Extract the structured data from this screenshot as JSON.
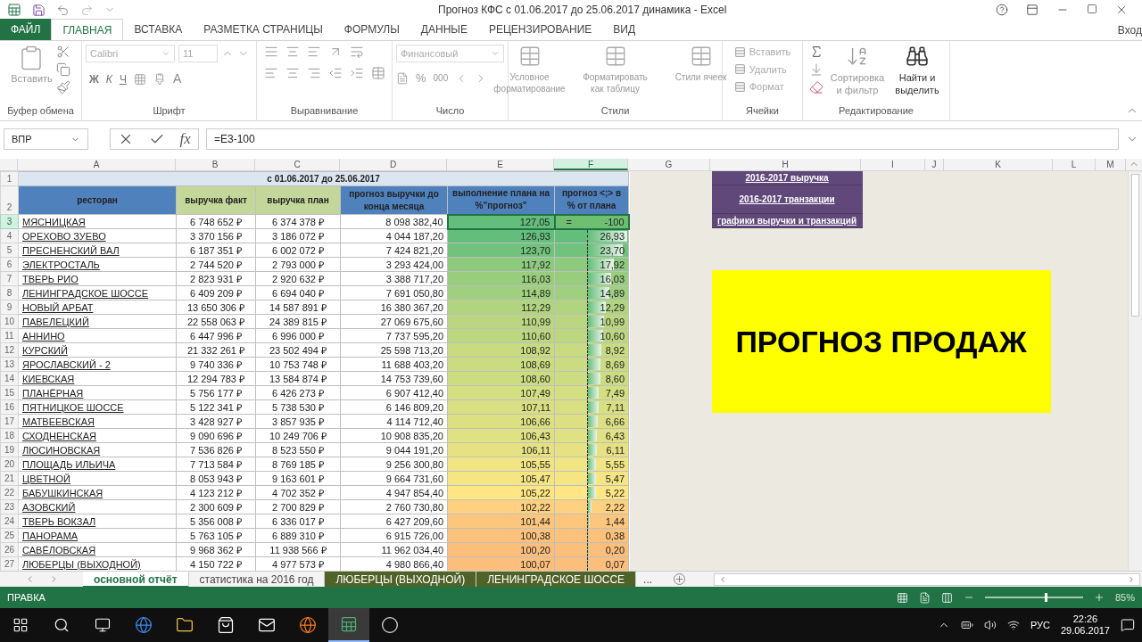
{
  "window": {
    "title": "Прогноз КФС с 01.06.2017 до 25.06.2017 динамика - Excel"
  },
  "ribbon_tabs": [
    {
      "label": "ФАЙЛ",
      "kind": "file",
      "selected": false
    },
    {
      "label": "ГЛАВНАЯ",
      "kind": "tab",
      "selected": true
    },
    {
      "label": "ВСТАВКА",
      "kind": "tab",
      "selected": false
    },
    {
      "label": "РАЗМЕТКА СТРАНИЦЫ",
      "kind": "tab",
      "selected": false
    },
    {
      "label": "ФОРМУЛЫ",
      "kind": "tab",
      "selected": false
    },
    {
      "label": "ДАННЫЕ",
      "kind": "tab",
      "selected": false
    },
    {
      "label": "РЕЦЕНЗИРОВАНИЕ",
      "kind": "tab",
      "selected": false
    },
    {
      "label": "ВИД",
      "kind": "tab",
      "selected": false
    }
  ],
  "account": "Вход",
  "ribbon": {
    "clipboard": {
      "label": "Буфер обмена",
      "paste": "Вставить"
    },
    "font": {
      "label": "Шрифт",
      "font": "Calibri",
      "size": "11",
      "bold": "Ж",
      "italic": "К",
      "underline": "Ч",
      "color_letter": "A"
    },
    "alignment": {
      "label": "Выравнивание"
    },
    "number": {
      "label": "Число",
      "format": "Финансовый",
      "percent": "%",
      "thousands": "000"
    },
    "styles": {
      "label": "Стили",
      "buttons": [
        "Условное форматирование",
        "Форматировать как таблицу",
        "Стили ячеек"
      ]
    },
    "cells": {
      "label": "Ячейки",
      "items": [
        "Вставить",
        "Удалить",
        "Формат"
      ]
    },
    "editing": {
      "label": "Редактирование",
      "sort": "Сортировка и фильтр",
      "find": "Найти и выделить"
    }
  },
  "formula_bar": {
    "name_box": "ВПР",
    "fx": "fx",
    "formula": "=E3-100"
  },
  "columns": [
    {
      "letter": "A",
      "selected": false
    },
    {
      "letter": "B",
      "selected": false
    },
    {
      "letter": "C",
      "selected": false
    },
    {
      "letter": "D",
      "selected": false
    },
    {
      "letter": "E",
      "selected": false
    },
    {
      "letter": "F",
      "selected": true
    },
    {
      "letter": "G",
      "selected": false
    },
    {
      "letter": "H",
      "selected": false
    },
    {
      "letter": "I",
      "selected": false
    },
    {
      "letter": "J",
      "selected": false
    },
    {
      "letter": "K",
      "selected": false
    },
    {
      "letter": "L",
      "selected": false
    },
    {
      "letter": "M",
      "selected": false
    }
  ],
  "sheet": {
    "title_row": {
      "row": "1",
      "text": "с 01.06.2017 до 25.06.2017"
    },
    "header_row": {
      "row": "2",
      "headers": [
        {
          "text": "ресторан",
          "color": "#4f81bd"
        },
        {
          "text": "выручка факт",
          "color": "#c4d79b"
        },
        {
          "text": "выручка план",
          "color": "#c4d79b"
        },
        {
          "text": "прогноз выручки до конца месяца",
          "color": "#4f81bd"
        },
        {
          "text": "выполнение плана на %\"прогноз\"",
          "color": "#4f81bd"
        },
        {
          "text": "прогноз <;> в % от плана",
          "color": "#4f81bd"
        }
      ]
    },
    "rows": [
      {
        "row": "3",
        "name": "МЯСНИЦКАЯ",
        "fact": "6 748 652 ₽",
        "plan": "6 374 378 ₽",
        "forecast": "8 098 382,40",
        "pct": "127,05",
        "color": "#63be7b",
        "delta": "-100",
        "selected": true,
        "editing": true,
        "edit_text": "="
      },
      {
        "row": "4",
        "name": "ОРЕХОВО ЗУЕВО",
        "fact": "3 370 156 ₽",
        "plan": "3 186 072 ₽",
        "forecast": "4 044 187,20",
        "pct": "126,93",
        "color": "#64be7b",
        "delta": "26,93",
        "selected": false,
        "editing": false
      },
      {
        "row": "5",
        "name": "ПРЕСНЕНСКИЙ ВАЛ",
        "fact": "6 187 351 ₽",
        "plan": "6 002 072 ₽",
        "forecast": "7 424 821,20",
        "pct": "123,70",
        "color": "#70c27c",
        "delta": "23,70",
        "selected": false,
        "editing": false
      },
      {
        "row": "6",
        "name": "ЭЛЕКТРОСТАЛЬ",
        "fact": "2 744 520 ₽",
        "plan": "2 793 000 ₽",
        "forecast": "3 293 424,00",
        "pct": "117,92",
        "color": "#8dca7e",
        "delta": "17,92",
        "selected": false,
        "editing": false
      },
      {
        "row": "7",
        "name": "ТВЕРЬ РИО",
        "fact": "2 823 931 ₽",
        "plan": "2 920 632 ₽",
        "forecast": "3 388 717,20",
        "pct": "116,03",
        "color": "#98cd7e",
        "delta": "16,03",
        "selected": false,
        "editing": false
      },
      {
        "row": "8",
        "name": "ЛЕНИНГРАДСКОЕ ШОССЕ",
        "fact": "6 409 209 ₽",
        "plan": "6 694 040 ₽",
        "forecast": "7 691 050,80",
        "pct": "114,89",
        "color": "#a0cf7f",
        "delta": "14,89",
        "selected": false,
        "editing": false
      },
      {
        "row": "9",
        "name": "НОВЫЙ АРБАТ",
        "fact": "13 650 306 ₽",
        "plan": "14 587 891 ₽",
        "forecast": "16 380 367,20",
        "pct": "112,29",
        "color": "#b1d480",
        "delta": "12,29",
        "selected": false,
        "editing": false
      },
      {
        "row": "10",
        "name": "ПАВЕЛЕЦКИЙ",
        "fact": "22 558 063 ₽",
        "plan": "24 389 815 ₽",
        "forecast": "27 069 675,60",
        "pct": "110,99",
        "color": "#bad681",
        "delta": "10,99",
        "selected": false,
        "editing": false
      },
      {
        "row": "11",
        "name": "АННИНО",
        "fact": "6 447 996 ₽",
        "plan": "6 996 000 ₽",
        "forecast": "7 737 595,20",
        "pct": "110,60",
        "color": "#bdd781",
        "delta": "10,60",
        "selected": false,
        "editing": false
      },
      {
        "row": "12",
        "name": "КУРСКИЙ",
        "fact": "21 332 261 ₽",
        "plan": "23 502 494 ₽",
        "forecast": "25 598 713,20",
        "pct": "108,92",
        "color": "#c9db81",
        "delta": "8,92",
        "selected": false,
        "editing": false
      },
      {
        "row": "13",
        "name": "ЯРОСЛАВСКИЙ - 2",
        "fact": "9 740 336 ₽",
        "plan": "10 753 748 ₽",
        "forecast": "11 688 403,20",
        "pct": "108,69",
        "color": "#cbdb81",
        "delta": "8,69",
        "selected": false,
        "editing": false
      },
      {
        "row": "14",
        "name": "КИЕВСКАЯ",
        "fact": "12 294 783 ₽",
        "plan": "13 584 874 ₽",
        "forecast": "14 753 739,60",
        "pct": "108,60",
        "color": "#ccdc81",
        "delta": "8,60",
        "selected": false,
        "editing": false
      },
      {
        "row": "15",
        "name": "ПЛАНЁРНАЯ",
        "fact": "5 756 177 ₽",
        "plan": "6 426 273 ₽",
        "forecast": "6 907 412,40",
        "pct": "107,49",
        "color": "#d4de82",
        "delta": "7,49",
        "selected": false,
        "editing": false
      },
      {
        "row": "16",
        "name": "ПЯТНИЦКОЕ ШОССЕ",
        "fact": "5 122 341 ₽",
        "plan": "5 738 530 ₽",
        "forecast": "6 146 809,20",
        "pct": "107,11",
        "color": "#d8df82",
        "delta": "7,11",
        "selected": false,
        "editing": false
      },
      {
        "row": "17",
        "name": "МАТВЕЕВСКАЯ",
        "fact": "3 428 927 ₽",
        "plan": "3 857 935 ₽",
        "forecast": "4 114 712,40",
        "pct": "106,66",
        "color": "#dce082",
        "delta": "6,66",
        "selected": false,
        "editing": false
      },
      {
        "row": "18",
        "name": "СХОДНЕНСКАЯ",
        "fact": "9 090 696 ₽",
        "plan": "10 249 706 ₽",
        "forecast": "10 908 835,20",
        "pct": "106,43",
        "color": "#e0e183",
        "delta": "6,43",
        "selected": false,
        "editing": false
      },
      {
        "row": "19",
        "name": "ЛЮСИНОВСКАЯ",
        "fact": "7 536 826 ₽",
        "plan": "8 523 550 ₽",
        "forecast": "9 044 191,20",
        "pct": "106,11",
        "color": "#e6e283",
        "delta": "6,11",
        "selected": false,
        "editing": false
      },
      {
        "row": "20",
        "name": "ПЛОЩАДЬ ИЛЬИЧА",
        "fact": "7 713 584 ₽",
        "plan": "8 769 185 ₽",
        "forecast": "9 256 300,80",
        "pct": "105,55",
        "color": "#f0e483",
        "delta": "5,55",
        "selected": false,
        "editing": false
      },
      {
        "row": "21",
        "name": "ЦВЕТНОЙ",
        "fact": "8 053 943 ₽",
        "plan": "9 163 601 ₽",
        "forecast": "9 664 731,60",
        "pct": "105,47",
        "color": "#f6e683",
        "delta": "5,47",
        "selected": false,
        "editing": false
      },
      {
        "row": "22",
        "name": "БАБУШКИНСКАЯ",
        "fact": "4 123 212 ₽",
        "plan": "4 702 352 ₽",
        "forecast": "4 947 854,40",
        "pct": "105,22",
        "color": "#fde683",
        "delta": "5,22",
        "selected": false,
        "editing": false
      },
      {
        "row": "23",
        "name": "АЗОВСКИЙ",
        "fact": "2 300 609 ₽",
        "plan": "2 700 829 ₽",
        "forecast": "2 760 730,80",
        "pct": "102,22",
        "color": "#fdd17f",
        "delta": "2,22",
        "selected": false,
        "editing": false
      },
      {
        "row": "24",
        "name": "ТВЕРЬ ВОКЗАЛ",
        "fact": "5 356 008 ₽",
        "plan": "6 336 017 ₽",
        "forecast": "6 427 209,60",
        "pct": "101,44",
        "color": "#fcc77d",
        "delta": "1,44",
        "selected": false,
        "editing": false
      },
      {
        "row": "25",
        "name": "ПАНОРАМА",
        "fact": "5 763 105 ₽",
        "plan": "6 889 310 ₽",
        "forecast": "6 915 726,00",
        "pct": "100,38",
        "color": "#fcc27c",
        "delta": "0,38",
        "selected": false,
        "editing": false
      },
      {
        "row": "26",
        "name": "САВЁЛОВСКАЯ",
        "fact": "9 968 362 ₽",
        "plan": "11 938 566 ₽",
        "forecast": "11 962 034,40",
        "pct": "100,20",
        "color": "#fcbf7b",
        "delta": "0,20",
        "selected": false,
        "editing": false
      },
      {
        "row": "27",
        "name": "ЛЮБЕРЦЫ (ВЫХОДНОЙ)",
        "fact": "4 150 722 ₽",
        "plan": "4 977 573 ₽",
        "forecast": "4 980 866,40",
        "pct": "100,07",
        "color": "#fcbe7b",
        "delta": "0,07",
        "selected": false,
        "editing": false
      }
    ]
  },
  "links": [
    "2016-2017 выручка",
    "2016-2017 транзакции",
    "графики выручки и транзакций"
  ],
  "banner": "ПРОГНОЗ ПРОДАЖ",
  "sheet_tabs": [
    {
      "label": "основной отчёт",
      "selected": true
    },
    {
      "label": "статистика на 2016 год",
      "selected": false
    },
    {
      "label": "ЛЮБЕРЦЫ (ВЫХОДНОЙ)",
      "selected": false,
      "color": "#4f6228"
    },
    {
      "label": "ЛЕНИНГРАДСКОЕ ШОССЕ",
      "selected": false,
      "color": "#4f6228"
    }
  ],
  "more_tabs": "...",
  "status_bar": {
    "mode": "ПРАВКА",
    "zoom": "85%",
    "zoom_slider": {
      "level": 0.63
    }
  },
  "taskbar": {
    "apps": [
      {
        "kind": "edge",
        "active": false
      },
      {
        "kind": "explorer",
        "active": false
      },
      {
        "kind": "store",
        "active": false
      },
      {
        "kind": "mail",
        "active": false
      },
      {
        "kind": "firefox",
        "active": false
      },
      {
        "kind": "excel",
        "active": true
      },
      {
        "kind": "other",
        "active": false
      }
    ],
    "language": "РУС",
    "time": "22:26",
    "date": "29.06.2017"
  }
}
